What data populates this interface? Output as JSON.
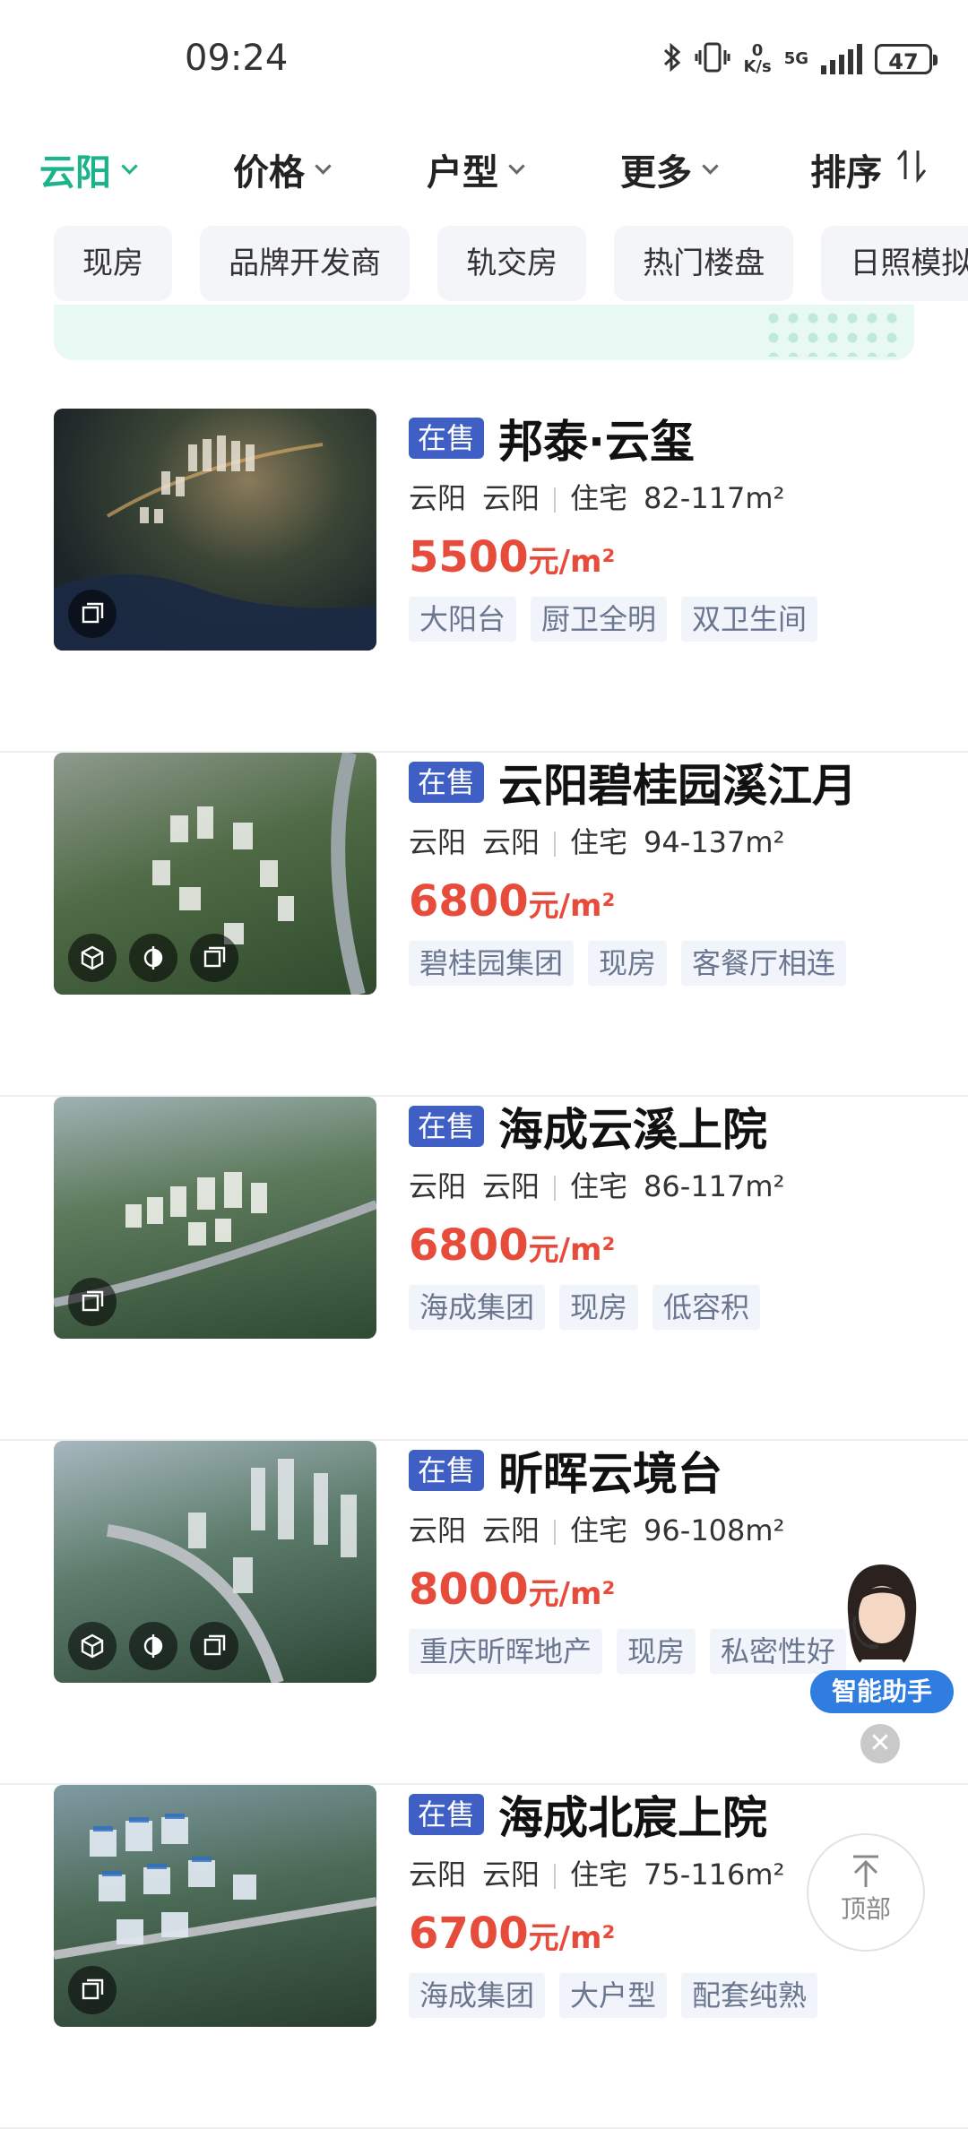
{
  "status_bar": {
    "time": "09:24",
    "net_speed_top": "0",
    "net_speed_unit": "K/s",
    "signal_type": "5G",
    "battery": "47"
  },
  "filters": [
    {
      "label": "云阳",
      "active": true
    },
    {
      "label": "价格",
      "active": false
    },
    {
      "label": "户型",
      "active": false
    },
    {
      "label": "更多",
      "active": false
    },
    {
      "label": "排序",
      "active": false
    }
  ],
  "chips": [
    "现房",
    "品牌开发商",
    "轨交房",
    "热门楼盘",
    "日照模拟"
  ],
  "listings": [
    {
      "status": "在售",
      "name": "邦泰·云玺",
      "district": "云阳",
      "area": "云阳",
      "type": "住宅",
      "size": "82-117m²",
      "price": "5500",
      "price_unit": "元/m²",
      "tags": [
        "大阳台",
        "厨卫全明",
        "双卫生间"
      ],
      "icons": [
        "floorplan-icon"
      ]
    },
    {
      "status": "在售",
      "name": "云阳碧桂园溪江月",
      "district": "云阳",
      "area": "云阳",
      "type": "住宅",
      "size": "94-137m²",
      "price": "6800",
      "price_unit": "元/m²",
      "tags": [
        "碧桂园集团",
        "现房",
        "客餐厅相连"
      ],
      "icons": [
        "vr-cube-icon",
        "sunlight-icon",
        "floorplan-icon"
      ]
    },
    {
      "status": "在售",
      "name": "海成云溪上院",
      "district": "云阳",
      "area": "云阳",
      "type": "住宅",
      "size": "86-117m²",
      "price": "6800",
      "price_unit": "元/m²",
      "tags": [
        "海成集团",
        "现房",
        "低容积"
      ],
      "icons": [
        "floorplan-icon"
      ]
    },
    {
      "status": "在售",
      "name": "昕晖云境台",
      "district": "云阳",
      "area": "云阳",
      "type": "住宅",
      "size": "96-108m²",
      "price": "8000",
      "price_unit": "元/m²",
      "tags": [
        "重庆昕晖地产",
        "现房",
        "私密性好"
      ],
      "icons": [
        "vr-cube-icon",
        "sunlight-icon",
        "floorplan-icon"
      ]
    },
    {
      "status": "在售",
      "name": "海成北宸上院",
      "district": "云阳",
      "area": "云阳",
      "type": "住宅",
      "size": "75-116m²",
      "price": "6700",
      "price_unit": "元/m²",
      "tags": [
        "海成集团",
        "大户型",
        "配套纯熟"
      ],
      "icons": [
        "floorplan-icon"
      ]
    }
  ],
  "assistant": {
    "label": "智能助手"
  },
  "to_top": {
    "label": "顶部"
  },
  "colors": {
    "accent": "#1bb48a",
    "sale_badge": "#3f5fc4",
    "price": "#e74b3c",
    "assistant": "#2f7de1"
  }
}
